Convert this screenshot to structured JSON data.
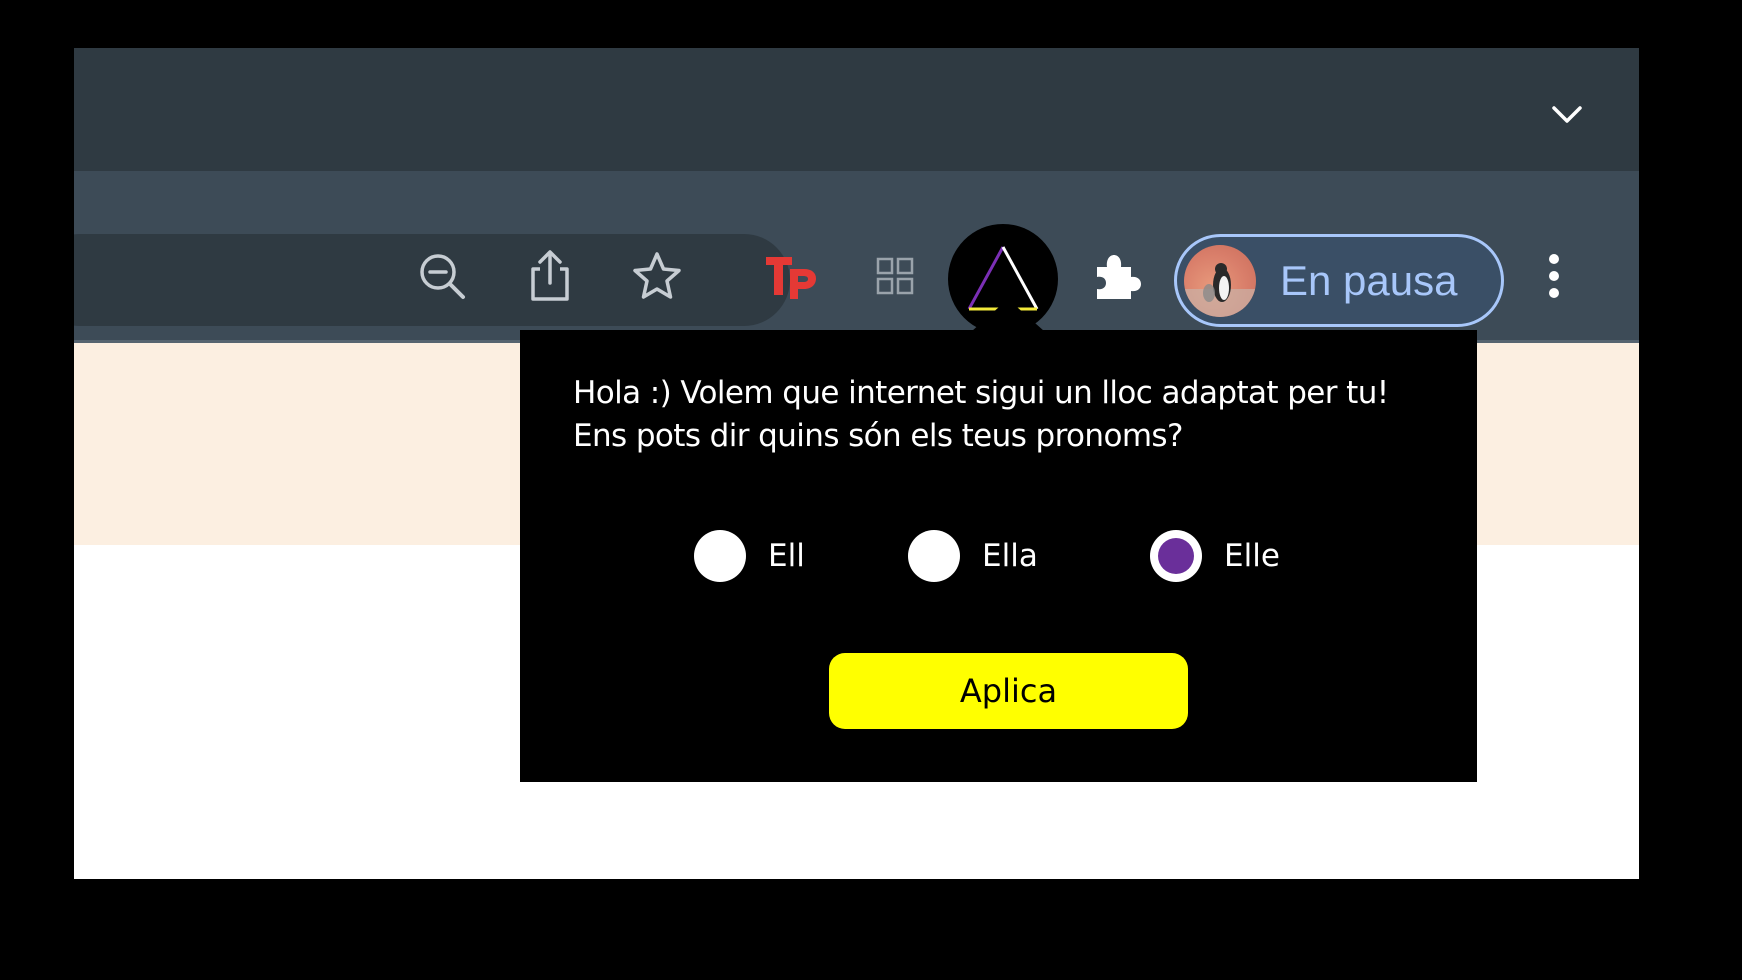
{
  "popup": {
    "message": "Hola :) Volem que internet sigui un lloc adaptat per tu! Ens pots dir quins són els teus pronoms?",
    "options": [
      {
        "label": "Ell",
        "selected": false
      },
      {
        "label": "Ella",
        "selected": false
      },
      {
        "label": "Elle",
        "selected": true
      }
    ],
    "apply_label": "Aplica"
  },
  "toolbar": {
    "icons": [
      "zoom-out-icon",
      "share-icon",
      "bookmark-star-icon"
    ],
    "extensions": [
      "tp-extension-icon",
      "grid-extension-icon",
      "triangle-extension-icon",
      "puzzle-extensions-icon"
    ],
    "profile_label": "En pausa",
    "menu_icon": "kebab-menu-icon"
  },
  "colors": {
    "accent_yellow": "#ffff00",
    "radio_selected": "#6a2f9a",
    "profile_text": "#a8c7fa",
    "tp_red": "#e53935"
  }
}
